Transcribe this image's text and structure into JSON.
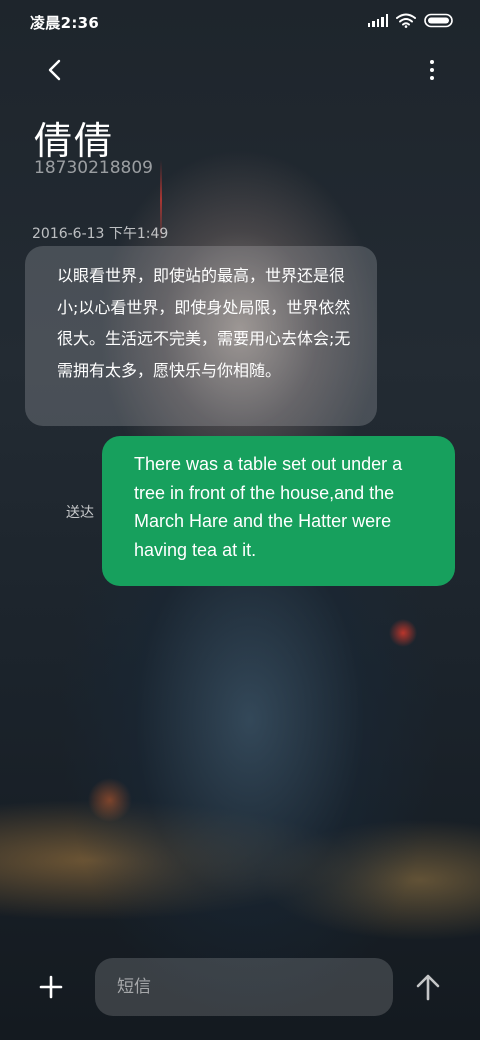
{
  "status_bar": {
    "time": "凌晨2:36",
    "icons": [
      "signal-icon",
      "wifi-icon",
      "battery-icon"
    ]
  },
  "header": {
    "back_icon": "back-arrow-icon",
    "more_icon": "more-vertical-icon",
    "contact_name": "倩倩",
    "contact_number": "18730218809"
  },
  "conversation": {
    "timestamp": "2016-6-13 下午1:49",
    "incoming_message": "以眼看世界，即使站的最高，世界还是很小;以心看世界，即使身处局限，世界依然很大。生活远不完美，需要用心去体会;无需拥有太多，愿快乐与你相随。",
    "outgoing_message": "There was a table set out under a tree in front of the house,and the March Hare and the Hatter were having tea at it.",
    "outgoing_status": "送达"
  },
  "composer": {
    "add_icon": "plus-icon",
    "input_placeholder": "短信",
    "send_icon": "send-arrow-icon"
  },
  "colors": {
    "outgoing_bubble": "#17a05d",
    "incoming_bubble": "rgba(215,215,220,0.22)",
    "text": "#ffffff"
  }
}
